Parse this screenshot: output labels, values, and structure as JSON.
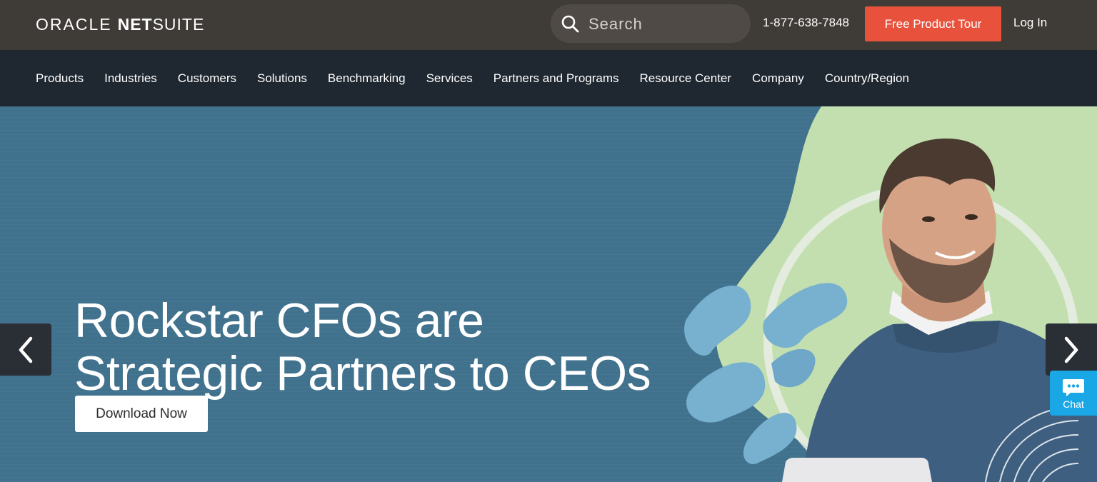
{
  "brand": {
    "oracle": "ORACLE",
    "net": "NET",
    "suite": "SUITE"
  },
  "search": {
    "placeholder": "Search"
  },
  "utility": {
    "phone": "1-877-638-7848",
    "tour_label": "Free Product Tour",
    "login_label": "Log In"
  },
  "nav": {
    "items": [
      {
        "label": "Products"
      },
      {
        "label": "Industries"
      },
      {
        "label": "Customers"
      },
      {
        "label": "Solutions"
      },
      {
        "label": "Benchmarking"
      },
      {
        "label": "Services"
      },
      {
        "label": "Partners and Programs"
      },
      {
        "label": "Resource Center"
      },
      {
        "label": "Company"
      },
      {
        "label": "Country/Region"
      }
    ]
  },
  "hero": {
    "headline_line1": "Rockstar CFOs are",
    "headline_line2": "Strategic Partners to CEOs",
    "cta_label": "Download Now"
  },
  "chat": {
    "label": "Chat"
  },
  "colors": {
    "topbar": "#3f3b37",
    "nav": "#1f2730",
    "hero_bg": "#40718d",
    "accent_orange": "#e8523c",
    "chat_blue": "#1aa7e6",
    "hero_green": "#c3dfb0"
  },
  "icons": {
    "search": "search-icon",
    "prev": "chevron-left-icon",
    "next": "chevron-right-icon",
    "chat": "chat-bubble-icon"
  }
}
